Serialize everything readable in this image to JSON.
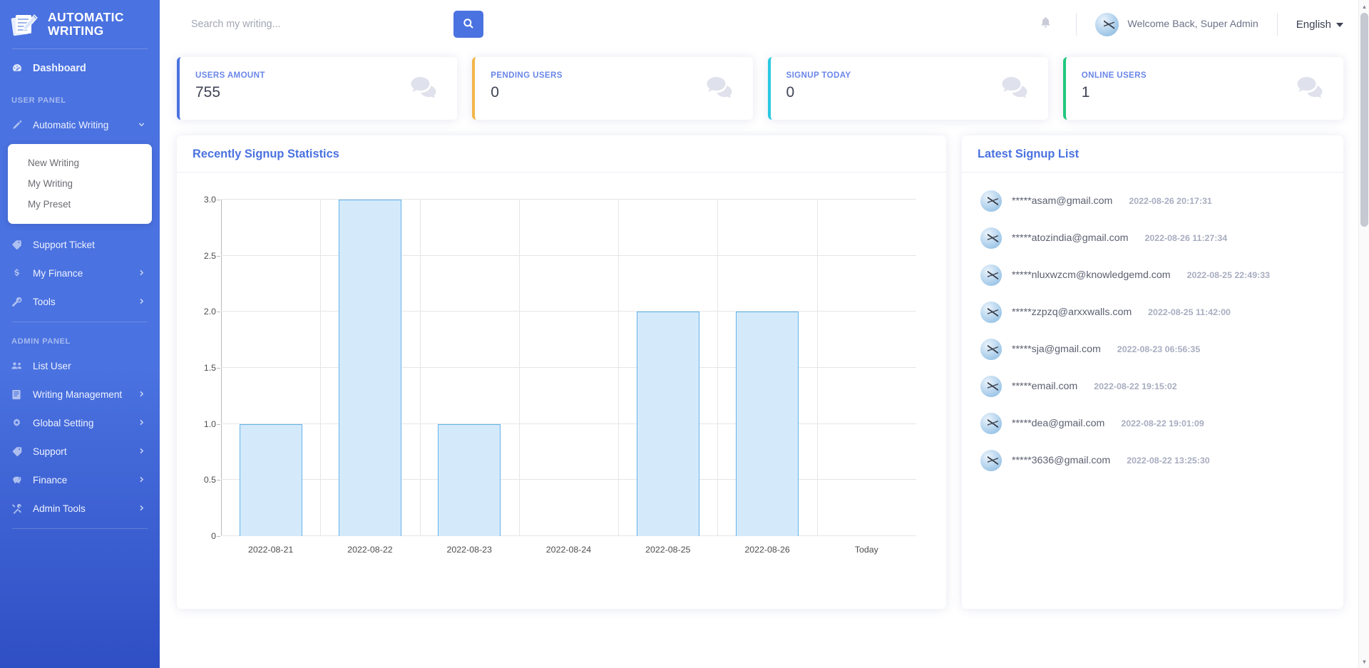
{
  "brand": {
    "title_line1": "AUTOMATIC",
    "title_line2": "WRITING",
    "icon": "writing-pen-document-icon"
  },
  "sidebar": {
    "dashboard": {
      "label": "Dashboard",
      "icon": "gauge-icon"
    },
    "user_panel_label": "USER PANEL",
    "admin_panel_label": "ADMIN PANEL",
    "user_items": [
      {
        "label": "Automatic Writing",
        "icon": "pencil-icon",
        "expandable": true,
        "expanded": true
      },
      {
        "label": "Support Ticket",
        "icon": "tag-icon",
        "expandable": false
      },
      {
        "label": "My Finance",
        "icon": "dollar-icon",
        "expandable": true
      },
      {
        "label": "Tools",
        "icon": "wrench-icon",
        "expandable": true
      }
    ],
    "submenu": [
      {
        "label": "New Writing"
      },
      {
        "label": "My Writing"
      },
      {
        "label": "My Preset"
      }
    ],
    "admin_items": [
      {
        "label": "List User",
        "icon": "users-icon",
        "expandable": false
      },
      {
        "label": "Writing Management",
        "icon": "book-icon",
        "expandable": true
      },
      {
        "label": "Global Setting",
        "icon": "gear-icon",
        "expandable": true
      },
      {
        "label": "Support",
        "icon": "tag-icon",
        "expandable": true
      },
      {
        "label": "Finance",
        "icon": "piggy-bank-icon",
        "expandable": true
      },
      {
        "label": "Admin Tools",
        "icon": "tools-icon",
        "expandable": true
      }
    ]
  },
  "header": {
    "search_placeholder": "Search my writing...",
    "search_value": "",
    "search_button_icon": "search-icon",
    "notification_icon": "bell-icon",
    "welcome_text": "Welcome Back, Super Admin",
    "language": "English",
    "language_caret_icon": "caret-down-icon",
    "avatar_icon": "user-avatar"
  },
  "stats": [
    {
      "label": "USERS AMOUNT",
      "value": "755",
      "accent": "#4a72e0",
      "icon": "chat-bubbles-icon"
    },
    {
      "label": "PENDING USERS",
      "value": "0",
      "accent": "#f3b54a",
      "icon": "chat-bubbles-icon"
    },
    {
      "label": "SIGNUP TODAY",
      "value": "0",
      "accent": "#2bc9e0",
      "icon": "chat-bubbles-icon"
    },
    {
      "label": "ONLINE USERS",
      "value": "1",
      "accent": "#22c77e",
      "icon": "chat-bubbles-icon"
    }
  ],
  "chart_panel": {
    "title": "Recently Signup Statistics"
  },
  "chart_data": {
    "type": "bar",
    "title": "Recently Signup Statistics",
    "xlabel": "",
    "ylabel": "",
    "categories": [
      "2022-08-21",
      "2022-08-22",
      "2022-08-23",
      "2022-08-24",
      "2022-08-25",
      "2022-08-26",
      "Today"
    ],
    "values": [
      1,
      3,
      1,
      0,
      2,
      2,
      0
    ],
    "ylim": [
      0,
      3
    ],
    "yticks": [
      "0",
      "0.5",
      "1.0",
      "1.5",
      "2.0",
      "2.5",
      "3.0"
    ],
    "ytick_values": [
      0,
      0.5,
      1.0,
      1.5,
      2.0,
      2.5,
      3.0
    ],
    "grid": true,
    "legend": false,
    "bar_fill": "#d4eafb",
    "bar_border": "#63b3ea"
  },
  "signup_panel": {
    "title": "Latest Signup List",
    "rows": [
      {
        "email": "*****asam@gmail.com",
        "date": "2022-08-26 20:17:31"
      },
      {
        "email": "*****atozindia@gmail.com",
        "date": "2022-08-26 11:27:34"
      },
      {
        "email": "*****nluxwzcm@knowledgemd.com",
        "date": "2022-08-25 22:49:33"
      },
      {
        "email": "*****zzpzq@arxxwalls.com",
        "date": "2022-08-25 11:42:00"
      },
      {
        "email": "*****sja@gmail.com",
        "date": "2022-08-23 06:56:35"
      },
      {
        "email": "*****email.com",
        "date": "2022-08-22 19:15:02"
      },
      {
        "email": "*****dea@gmail.com",
        "date": "2022-08-22 19:01:09"
      },
      {
        "email": "*****3636@gmail.com",
        "date": "2022-08-22 13:25:30"
      }
    ]
  }
}
